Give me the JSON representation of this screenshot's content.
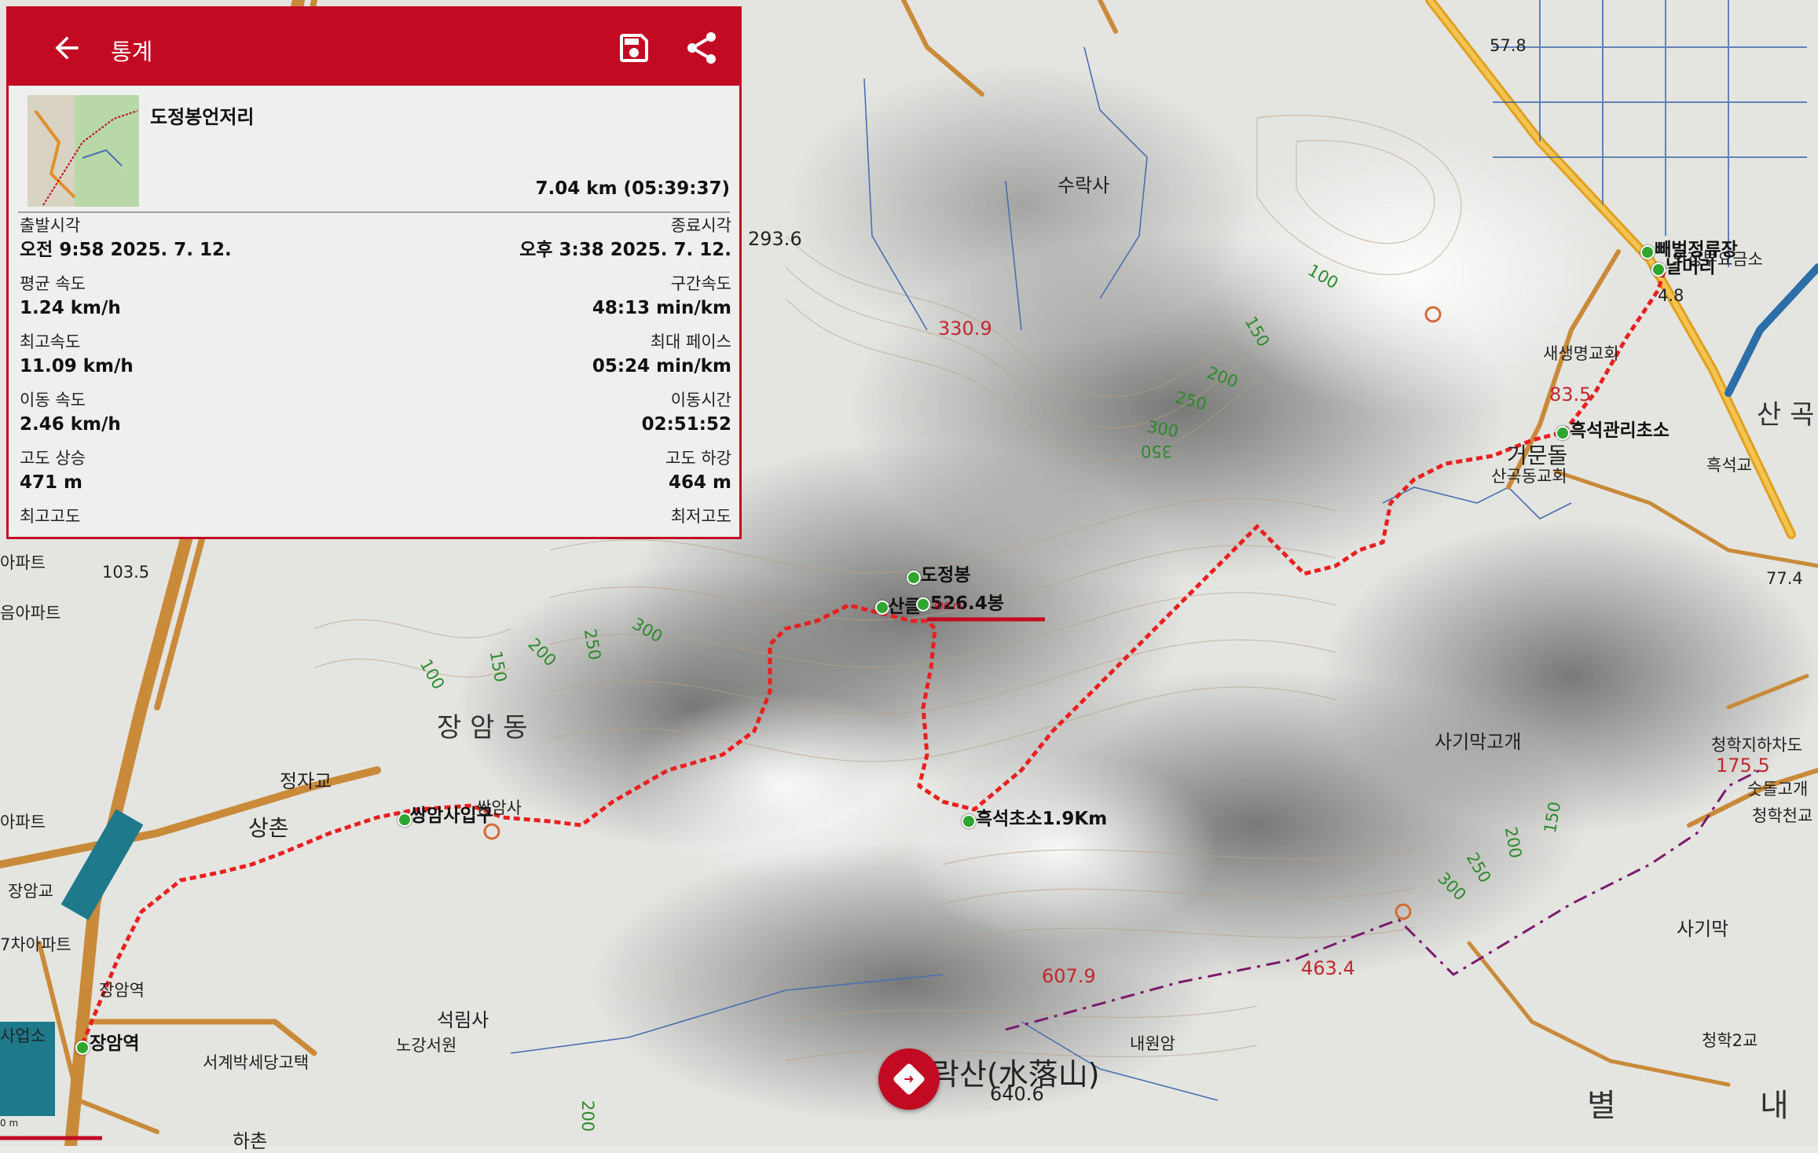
{
  "app": {
    "title": "통계",
    "icons": {
      "back": "back-arrow-icon",
      "save": "save-icon",
      "share": "share-icon"
    }
  },
  "track": {
    "name": "도정봉언저리",
    "distance_time": "7.04 km (05:39:37)"
  },
  "stats": [
    {
      "left_key": "출발시각",
      "left_val": "오전 9:58 2025. 7. 12.",
      "right_key": "종료시각",
      "right_val": "오후 3:38 2025. 7. 12."
    },
    {
      "left_key": "평균 속도",
      "left_val": "1.24 km/h",
      "right_key": "구간속도",
      "right_val": "48:13 min/km"
    },
    {
      "left_key": "최고속도",
      "left_val": "11.09 km/h",
      "right_key": "최대 페이스",
      "right_val": "05:24 min/km"
    },
    {
      "left_key": "이동 속도",
      "left_val": "2.46 km/h",
      "right_key": "이동시간",
      "right_val": "02:51:52"
    },
    {
      "left_key": "고도 상승",
      "left_val": "471 m",
      "right_key": "고도 하강",
      "right_val": "464 m"
    },
    {
      "left_key": "최고고도",
      "left_val": "",
      "right_key": "최저고도",
      "right_val": ""
    }
  ],
  "map": {
    "places": {
      "suraksa": "수락사",
      "jangamdong": "장 암 동",
      "sangchon": "상촌",
      "jeongjagyo": "정자교",
      "jangamgyo": "장암교",
      "seoklimsa": "석림사",
      "nogangseowon": "노강서원",
      "seonggye": "서계박세당고택",
      "jangamyeok_area": "장암역",
      "geomundol": "거문돌",
      "sangokchurch": "산곡동교회",
      "saesaengchurch": "새생명교회",
      "heukseokgyo": "흑석교",
      "sagimakgogae": "사기막고개",
      "sagimak": "사기막",
      "cheonghakjihachado": "청학지하차도",
      "sutdolgogae": "숫돌고개",
      "cheonghakcheongyo": "청학천교",
      "cheonghak2gyo": "청학2교",
      "naewonam": "내원암",
      "sangok": "산 곡",
      "byeol": "별",
      "nae": "내",
      "hachon": "하촌",
      "apt1": "아파트",
      "apt2": "음아파트",
      "apt3": "7차아파트",
      "apt4": "아파트",
      "eopso": "사업소",
      "ssangamsa": "쌍암사",
      "uijeongbu": "의정부요금소"
    },
    "mountain": "락산(水落山)",
    "peaks": [
      "330.9",
      "607.9",
      "463.4",
      "175.5"
    ],
    "heights": [
      "293.6",
      "640.6",
      "103.5",
      "57.8",
      "77.4",
      "4.8",
      "83.5"
    ],
    "contours": [
      "100",
      "150",
      "200",
      "250",
      "300",
      "350",
      "300",
      "250",
      "200",
      "150",
      "100",
      "300",
      "250",
      "200",
      "150",
      "200"
    ],
    "waypoints": {
      "dojeongbong": "도정봉",
      "sangilbong": "산클",
      "bong526": "526.4봉",
      "bbaebeol": "빼벌정류장",
      "nalmeori": "날머리",
      "heukseokgwanri": "흑석관리초소",
      "heukseokchoso": "흑석초소1.9Km",
      "ssangamipgu": "쌍암사입구",
      "jangamyeok": "장암역"
    },
    "scale": "300 m",
    "scale2": "0 m"
  },
  "fab": {
    "icon": "navigate-icon"
  }
}
